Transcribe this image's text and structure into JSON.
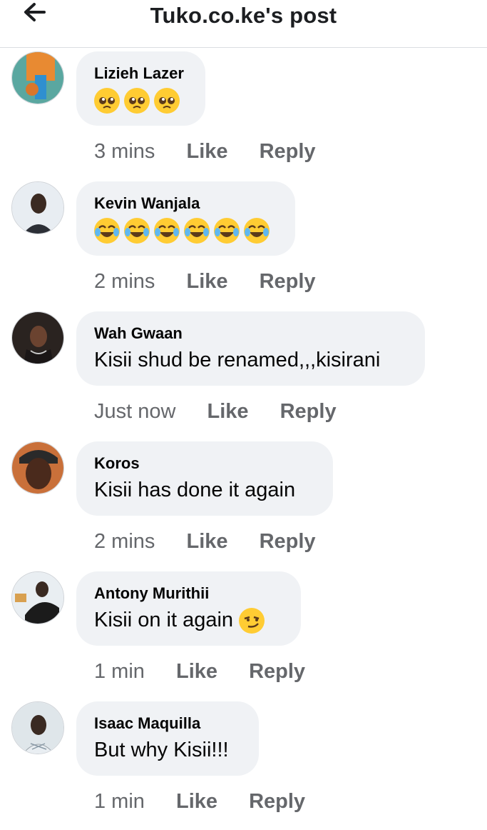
{
  "header": {
    "title": "Tuko.co.ke's post",
    "back_icon": "arrow-left-icon"
  },
  "comments": [
    {
      "author": "Lizieh Lazer",
      "text": "",
      "emoji": "pleading-face",
      "emoji_count": 3,
      "time": "3 mins",
      "like": "Like",
      "reply": "Reply"
    },
    {
      "author": "Kevin Wanjala",
      "text": "",
      "emoji": "tears-of-joy",
      "emoji_count": 6,
      "time": "2 mins",
      "like": "Like",
      "reply": "Reply"
    },
    {
      "author": "Wah Gwaan",
      "text": "Kisii shud be renamed,,,kisirani",
      "time": "Just now",
      "like": "Like",
      "reply": "Reply"
    },
    {
      "author": "Koros",
      "text": "Kisii has done it again",
      "time": "2 mins",
      "like": "Like",
      "reply": "Reply"
    },
    {
      "author": "Antony Murithii",
      "text": "Kisii on it again",
      "emoji": "smirk",
      "emoji_count": 1,
      "time": "1 min",
      "like": "Like",
      "reply": "Reply"
    },
    {
      "author": "Isaac Maquilla",
      "text": "But why Kisii!!!",
      "time": "1 min",
      "like": "Like",
      "reply": "Reply"
    }
  ],
  "colors": {
    "bubble": "#f0f2f5",
    "secondary_text": "#65676b",
    "divider": "#dadde1"
  }
}
